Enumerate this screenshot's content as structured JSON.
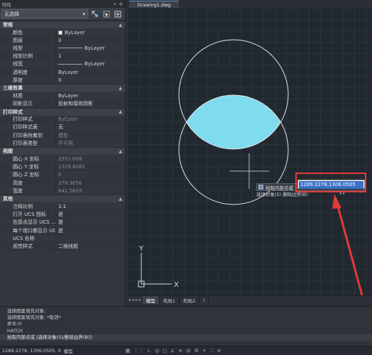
{
  "palette": {
    "title": "特性",
    "title_controls": [
      "✕",
      "✜"
    ],
    "selection": "无选择",
    "toolbar_icons": [
      "quick-select-icon",
      "select-objects-icon",
      "pickadd-icon"
    ],
    "sections": [
      {
        "name": "常规",
        "rows": [
          {
            "key": "颜色",
            "value": "ByLayer",
            "swatch": true
          },
          {
            "key": "图层",
            "value": "0"
          },
          {
            "key": "线型",
            "value": "ByLayer",
            "line": true
          },
          {
            "key": "线型比例",
            "value": "1"
          },
          {
            "key": "线宽",
            "value": "ByLayer",
            "line": true
          },
          {
            "key": "透明度",
            "value": "ByLayer"
          },
          {
            "key": "厚度",
            "value": "0"
          }
        ]
      },
      {
        "name": "三维效果",
        "rows": [
          {
            "key": "材质",
            "value": "ByLayer"
          },
          {
            "key": "阴影显示",
            "value": "投射和接收阴影"
          }
        ]
      },
      {
        "name": "打印样式",
        "rows": [
          {
            "key": "打印样式",
            "value": "ByColor",
            "dim": true
          },
          {
            "key": "打印样式表",
            "value": "无"
          },
          {
            "key": "打印表附着到",
            "value": "模型",
            "dim": true
          },
          {
            "key": "打印表类型",
            "value": "不可用",
            "dim": true
          }
        ]
      },
      {
        "name": "视图",
        "rows": [
          {
            "key": "圆心 X 坐标",
            "value": "1551.609",
            "dim": true
          },
          {
            "key": "圆心 Y 坐标",
            "value": "1329.8062",
            "dim": true
          },
          {
            "key": "圆心 Z 坐标",
            "value": "0",
            "dim": true
          },
          {
            "key": "高度",
            "value": "378.3656",
            "dim": true
          },
          {
            "key": "宽度",
            "value": "841.5619",
            "dim": true
          }
        ]
      },
      {
        "name": "其他",
        "rows": [
          {
            "key": "注释比例",
            "value": "1:1"
          },
          {
            "key": "打开 UCS 图标",
            "value": "是"
          },
          {
            "key": "在原点显示 UCS ...",
            "value": "是"
          },
          {
            "key": "每个视口都显示 UCS",
            "value": "是"
          },
          {
            "key": "UCS 名称",
            "value": ""
          },
          {
            "key": "视觉样式",
            "value": "二维线框"
          }
        ]
      }
    ]
  },
  "document": {
    "tab_title": "Drawing1.dwg"
  },
  "canvas": {
    "axis_y": "Y",
    "axis_x": "X",
    "prompt": "拾取内部点或",
    "coordinate_input": "1289.2278,1306.0505",
    "options": "选择对象(S)  删除边界(B)",
    "options_arrows": "◂ ▸",
    "colors": {
      "fill": "#7fdcee",
      "circle": "#e6e6e6",
      "background": "#212830",
      "highlight": "#e53935"
    }
  },
  "layout_tabs": {
    "nav": "◂ ◂ ▸ ▸",
    "tabs": [
      "模型",
      "布局1",
      "布局2"
    ],
    "active": "模型",
    "add": "/"
  },
  "command": {
    "history": [
      "选择图案填充对象:",
      "选择图案填充对象: *取消*",
      "命令:H",
      "HATCH"
    ],
    "current": "拾取内部点或 [选择对象(S)/删除边界(B)]:"
  },
  "status": {
    "coords": "1289.2278, 1306.0505, 0",
    "model_label": "模型"
  }
}
